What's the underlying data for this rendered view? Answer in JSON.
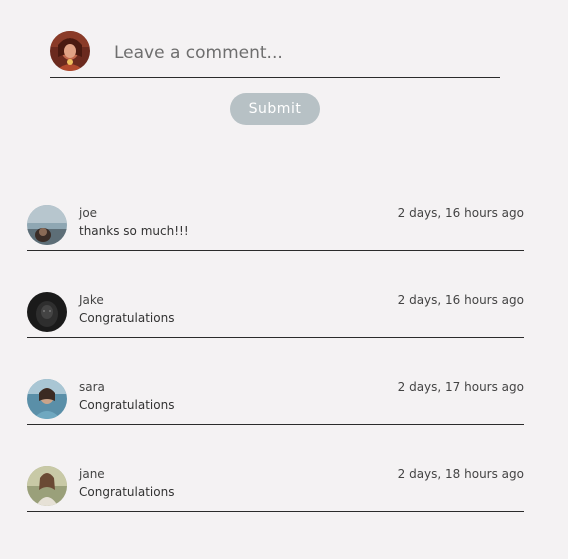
{
  "composer": {
    "placeholder": "Leave a comment...",
    "value": "",
    "avatar_icon": "user-avatar-icon"
  },
  "submit": {
    "label": "Submit",
    "color": "#b7c1c5"
  },
  "comments": [
    {
      "author": "joe",
      "time": "2 days, 16 hours ago",
      "text": "thanks so much!!!"
    },
    {
      "author": "Jake",
      "time": "2 days, 16 hours ago",
      "text": "Congratulations"
    },
    {
      "author": "sara",
      "time": "2 days, 17 hours ago",
      "text": "Congratulations"
    },
    {
      "author": "jane",
      "time": "2 days, 18 hours ago",
      "text": "Congratulations"
    }
  ]
}
